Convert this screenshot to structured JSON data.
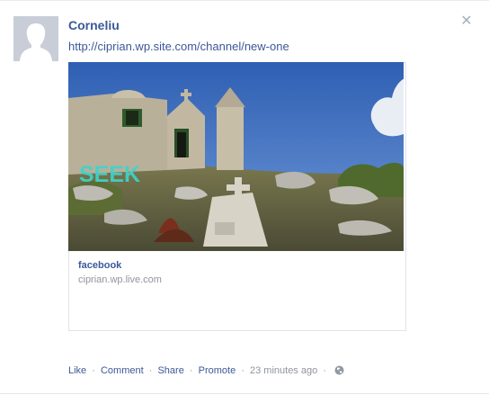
{
  "post": {
    "author": "Corneliu",
    "link_text": "http://ciprian.wp.site.com/channel/new-one",
    "close_icon": "close-icon",
    "attachment": {
      "title": "facebook",
      "domain": "ciprian.wp.live.com",
      "image_overlay_text": "SEEK"
    },
    "actions": {
      "like": "Like",
      "comment": "Comment",
      "share": "Share",
      "promote": "Promote",
      "timestamp": "23 minutes ago",
      "separator": "·",
      "privacy_icon": "globe-icon"
    }
  },
  "colors": {
    "link_blue": "#3b5998",
    "meta_gray": "#90949c",
    "overlay_text": "#3fd3c9"
  }
}
